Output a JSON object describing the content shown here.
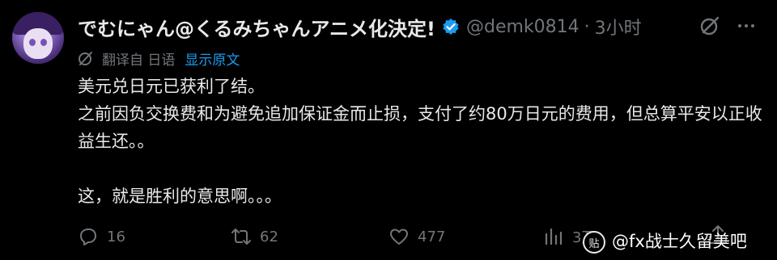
{
  "author": {
    "display_name": "でむにゃん@くるみちゃんアニメ化決定!",
    "handle": "@demk0814",
    "separator": "·",
    "time": "3小时"
  },
  "translation": {
    "note": "翻译自 日语",
    "show_original": "显示原文"
  },
  "body": {
    "line1": "美元兑日元已获利了结。",
    "line2": "之前因负交换费和为避免追加保证金而止损，支付了约80万日元的费用，但总算平安以正收益生还。。",
    "line3": "这，就是胜利的意思啊。。。"
  },
  "actions": {
    "replies": "16",
    "reposts": "62",
    "likes": "477",
    "views": "3万"
  },
  "watermark": {
    "icon_char": "贴",
    "text": "@fx战士久留美吧"
  },
  "colors": {
    "background": "#000000",
    "text": "#e7e9ea",
    "muted": "#71767b",
    "accent": "#1d9bf0"
  }
}
